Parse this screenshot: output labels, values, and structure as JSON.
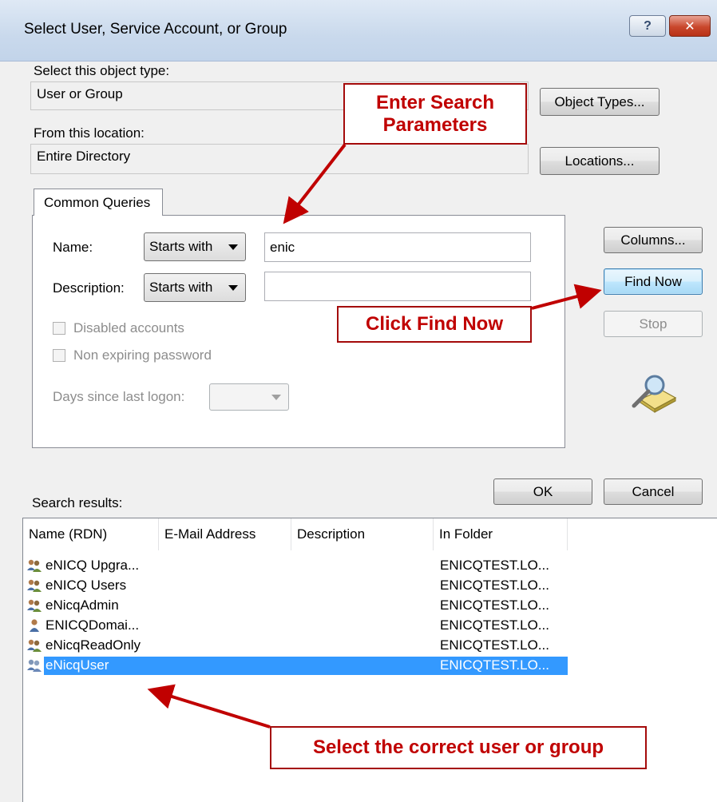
{
  "window": {
    "title": "Select User, Service Account, or Group",
    "help_glyph": "?",
    "close_glyph": "✕"
  },
  "object_type": {
    "label": "Select this object type:",
    "value": "User or Group",
    "button": "Object Types..."
  },
  "location": {
    "label": "From this location:",
    "value": "Entire Directory",
    "button": "Locations..."
  },
  "tabs": [
    {
      "label": "Common Queries",
      "selected": true
    }
  ],
  "query": {
    "name_label": "Name:",
    "name_mode": "Starts with",
    "name_value": "enic",
    "description_label": "Description:",
    "description_mode": "Starts with",
    "description_value": "",
    "disabled_accounts": "Disabled accounts",
    "non_expiring_password": "Non expiring password",
    "days_label": "Days since last logon:",
    "days_value": ""
  },
  "side_buttons": {
    "columns": "Columns...",
    "find_now": "Find Now",
    "stop": "Stop"
  },
  "dialog_buttons": {
    "ok": "OK",
    "cancel": "Cancel"
  },
  "results": {
    "label": "Search results:",
    "columns": [
      "Name (RDN)",
      "E-Mail Address",
      "Description",
      "In Folder"
    ],
    "rows": [
      {
        "icon": "group-icon",
        "name": "eNICQ Upgra...",
        "email": "",
        "description": "",
        "folder": "ENICQTEST.LO..."
      },
      {
        "icon": "group-icon",
        "name": "eNICQ Users",
        "email": "",
        "description": "",
        "folder": "ENICQTEST.LO..."
      },
      {
        "icon": "group-icon",
        "name": "eNicqAdmin",
        "email": "",
        "description": "",
        "folder": "ENICQTEST.LO..."
      },
      {
        "icon": "user-icon",
        "name": "ENICQDomai...",
        "email": "",
        "description": "",
        "folder": "ENICQTEST.LO..."
      },
      {
        "icon": "group-icon",
        "name": "eNicqReadOnly",
        "email": "",
        "description": "",
        "folder": "ENICQTEST.LO..."
      },
      {
        "icon": "group-icon",
        "name": "eNicqUser",
        "email": "",
        "description": "",
        "folder": "ENICQTEST.LO...",
        "selected": true
      }
    ]
  },
  "annotations": {
    "enter_search": "Enter Search Parameters",
    "click_find": "Click Find Now",
    "select_user": "Select the correct user or group",
    "color": "#c00000"
  },
  "colors": {
    "selection": "#3399ff",
    "dialog_bg": "#f0f0f0",
    "title_bg": "#c9d9ec"
  }
}
